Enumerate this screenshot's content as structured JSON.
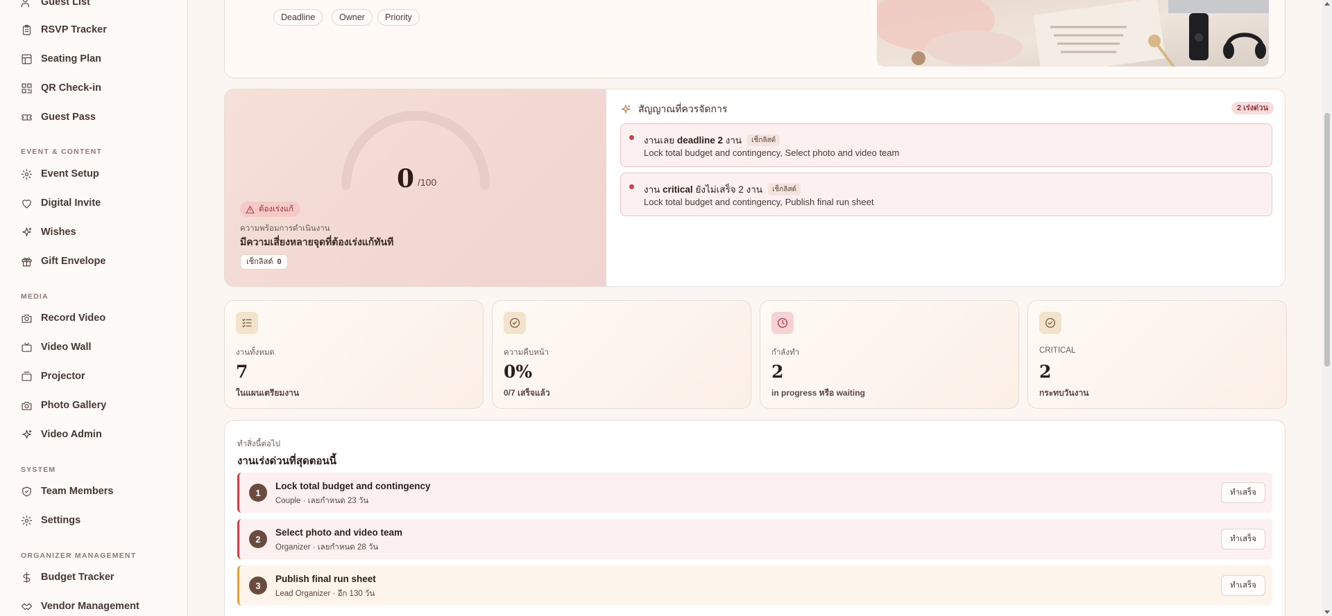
{
  "sidebar": {
    "items_top": [
      {
        "label": "Guest List",
        "icon": "user-icon"
      },
      {
        "label": "RSVP Tracker",
        "icon": "clipboard-icon"
      },
      {
        "label": "Seating Plan",
        "icon": "table-grid-icon"
      },
      {
        "label": "QR Check-in",
        "icon": "qr-code-icon"
      },
      {
        "label": "Guest Pass",
        "icon": "ticket-icon"
      }
    ],
    "section_event": "EVENT & CONTENT",
    "items_event": [
      {
        "label": "Event Setup",
        "icon": "gear-icon"
      },
      {
        "label": "Digital Invite",
        "icon": "heart-icon"
      },
      {
        "label": "Wishes",
        "icon": "sparkle-icon"
      },
      {
        "label": "Gift Envelope",
        "icon": "gift-icon"
      }
    ],
    "section_media": "MEDIA",
    "items_media": [
      {
        "label": "Record Video",
        "icon": "camera-icon"
      },
      {
        "label": "Video Wall",
        "icon": "tv-icon"
      },
      {
        "label": "Projector",
        "icon": "projector-icon"
      },
      {
        "label": "Photo Gallery",
        "icon": "camera-icon"
      },
      {
        "label": "Video Admin",
        "icon": "sparkle-icon"
      }
    ],
    "section_system": "SYSTEM",
    "items_system": [
      {
        "label": "Team Members",
        "icon": "shield-icon"
      },
      {
        "label": "Settings",
        "icon": "gear-icon"
      }
    ],
    "section_organizer": "ORGANIZER MANAGEMENT",
    "items_organizer": [
      {
        "label": "Budget Tracker",
        "icon": "dollar-icon"
      },
      {
        "label": "Vendor Management",
        "icon": "handshake-icon"
      }
    ]
  },
  "hero": {
    "chips": [
      "Deadline",
      "Owner",
      "Priority"
    ]
  },
  "readiness": {
    "score": "0",
    "score_max": "/100",
    "score_value": 0,
    "status_pill": "ต้องเร่งแก้",
    "caption": "ความพร้อมการดำเนินงาน",
    "title": "มีความเสี่ยงหลายจุดที่ต้องเร่งแก้ทันที",
    "checklist_label": "เช็กลิสต์",
    "checklist_count": "0"
  },
  "signals": {
    "heading": "สัญญาณที่ควรจัดการ",
    "urgent_count": "2 เร่งด่วน",
    "items": [
      {
        "title_prefix": "งานเลย ",
        "title_bold": "deadline 2",
        "title_suffix": " งาน",
        "tag": "เช็กลิสต์",
        "subtitle": "Lock total budget and contingency, Select photo and video team"
      },
      {
        "title_prefix": "งาน ",
        "title_bold": "critical",
        "title_suffix": " ยังไม่เสร็จ 2 งาน",
        "tag": "เช็กลิสต์",
        "subtitle": "Lock total budget and contingency, Publish final run sheet"
      }
    ]
  },
  "stats": [
    {
      "label": "งานทั้งหมด",
      "value": "7",
      "sub": "ในแผนเตรียมงาน",
      "icon": "checklist-icon",
      "icon_bg": "#f3e3cc",
      "icon_color": "#7a5a3c"
    },
    {
      "label": "ความคืบหน้า",
      "value": "0%",
      "sub": "0/7 เสร็จแล้ว",
      "icon": "check-circle-icon",
      "icon_bg": "#f3e3cc",
      "icon_color": "#7a5a3c"
    },
    {
      "label": "กำลังทำ",
      "value": "2",
      "sub": "in progress หรือ waiting",
      "icon": "clock-icon",
      "icon_bg": "#f7d2d4",
      "icon_color": "#b2373b"
    },
    {
      "label": "CRITICAL",
      "value": "2",
      "sub": "กระทบวันงาน",
      "icon": "check-circle-icon",
      "icon_bg": "#f3e3cc",
      "icon_color": "#7a5a3c"
    }
  ],
  "next": {
    "eyebrow": "ทำสิ่งนี้ต่อไป",
    "title": "งานเร่งด่วนที่สุดตอนนี้",
    "done_label": "ทำเสร็จ",
    "tasks": [
      {
        "num": "1",
        "title": "Lock total budget and contingency",
        "sub": "Couple · เลยกำหนด 23 วัน",
        "accent": "#c8444c",
        "bg": "#fdf0f0"
      },
      {
        "num": "2",
        "title": "Select photo and video team",
        "sub": "Organizer · เลยกำหนด 28 วัน",
        "accent": "#c8444c",
        "bg": "#fdf0f0"
      },
      {
        "num": "3",
        "title": "Publish final run sheet",
        "sub": "Lead Organizer · อีก 130 วัน",
        "accent": "#d9a441",
        "bg": "#fdf5ec"
      }
    ]
  }
}
